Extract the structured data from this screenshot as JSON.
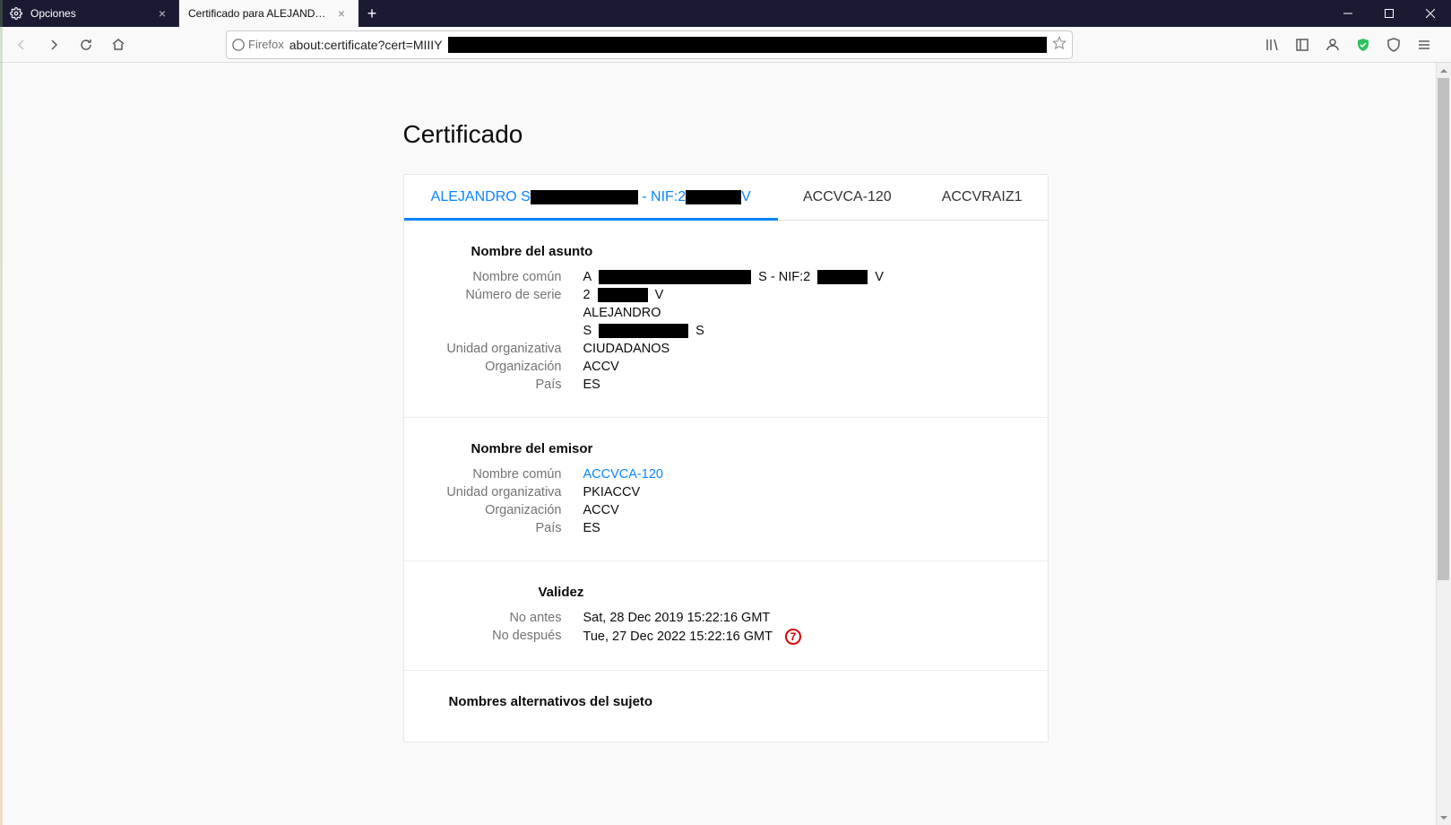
{
  "tabs": [
    {
      "title": "Opciones",
      "active": false
    },
    {
      "title": "Certificado para ALEJANDRO S████",
      "active": true
    }
  ],
  "url_prefix": "about:certificate?cert=MIIIY",
  "identity_label": "Firefox",
  "page": {
    "heading": "Certificado",
    "cert_tabs": [
      {
        "label_pre": "ALEJANDRO S",
        "label_mid_redact": true,
        "label_sep": " - NIF:2",
        "label_post_redact": true,
        "label_suffix": "V",
        "active": true
      },
      {
        "label": "ACCVCA-120"
      },
      {
        "label": "ACCVRAIZ1"
      }
    ],
    "subject": {
      "title": "Nombre del asunto",
      "rows": {
        "cn_label": "Nombre común",
        "cn_pre": "A",
        "cn_mid": "S - NIF:2",
        "cn_suff": "V",
        "serial_label": "Número de serie",
        "serial_pre": "2",
        "serial_suff": "V",
        "given": "ALEJANDRO",
        "surname_pre": "S",
        "surname_suff": "S",
        "ou_label": "Unidad organizativa",
        "ou": "CIUDADANOS",
        "org_label": "Organización",
        "org": "ACCV",
        "country_label": "País",
        "country": "ES"
      }
    },
    "issuer": {
      "title": "Nombre del emisor",
      "cn_label": "Nombre común",
      "cn": "ACCVCA-120",
      "ou_label": "Unidad organizativa",
      "ou": "PKIACCV",
      "org_label": "Organización",
      "org": "ACCV",
      "country_label": "País",
      "country": "ES"
    },
    "validity": {
      "title": "Validez",
      "not_before_label": "No antes",
      "not_before": "Sat, 28 Dec 2019 15:22:16 GMT",
      "not_after_label": "No después",
      "not_after": "Tue, 27 Dec 2022 15:22:16 GMT",
      "badge": "7"
    },
    "san": {
      "title": "Nombres alternativos del sujeto"
    }
  }
}
